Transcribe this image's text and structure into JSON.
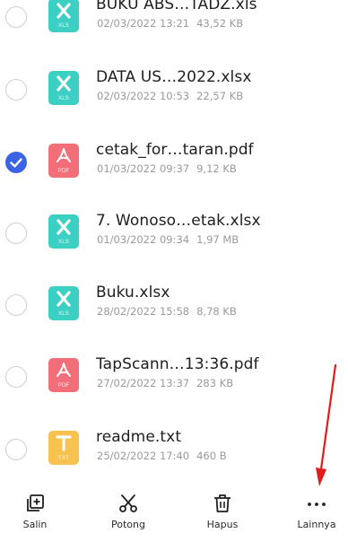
{
  "files": [
    {
      "name": "BUKU ABS…TADZ.xls",
      "date": "02/03/2022 13:21",
      "size": "43,52 KB",
      "type_label": "XLS",
      "icon": "excel-icon",
      "color": "#3ccfc3",
      "checked": false
    },
    {
      "name": "DATA US…2022.xlsx",
      "date": "02/03/2022 10:53",
      "size": "22,57 KB",
      "type_label": "XLS",
      "icon": "excel-icon",
      "color": "#3ccfc3",
      "checked": false
    },
    {
      "name": "cetak_for…taran.pdf",
      "date": "01/03/2022 09:37",
      "size": "9,12 KB",
      "type_label": "PDF",
      "icon": "pdf-icon",
      "color": "#f26f7a",
      "checked": true
    },
    {
      "name": "7. Wonoso…etak.xlsx",
      "date": "01/03/2022 09:34",
      "size": "1,97 MB",
      "type_label": "XLS",
      "icon": "excel-icon",
      "color": "#3ccfc3",
      "checked": false
    },
    {
      "name": "Buku.xlsx",
      "date": "28/02/2022 15:58",
      "size": "8,78 KB",
      "type_label": "XLS",
      "icon": "excel-icon",
      "color": "#3ccfc3",
      "checked": false
    },
    {
      "name": "TapScann…13:36.pdf",
      "date": "27/02/2022 13:37",
      "size": "283 KB",
      "type_label": "PDF",
      "icon": "pdf-icon",
      "color": "#f26f7a",
      "checked": false
    },
    {
      "name": "readme.txt",
      "date": "25/02/2022 17:40",
      "size": "460 B",
      "type_label": "TXT",
      "icon": "text-file-icon",
      "color": "#f8c24e",
      "checked": false
    }
  ],
  "toolbar": {
    "copy_label": "Salin",
    "cut_label": "Potong",
    "delete_label": "Hapus",
    "more_label": "Lainnya"
  },
  "colors": {
    "accent": "#3b63e6",
    "annotation_arrow": "#e31b1b"
  }
}
